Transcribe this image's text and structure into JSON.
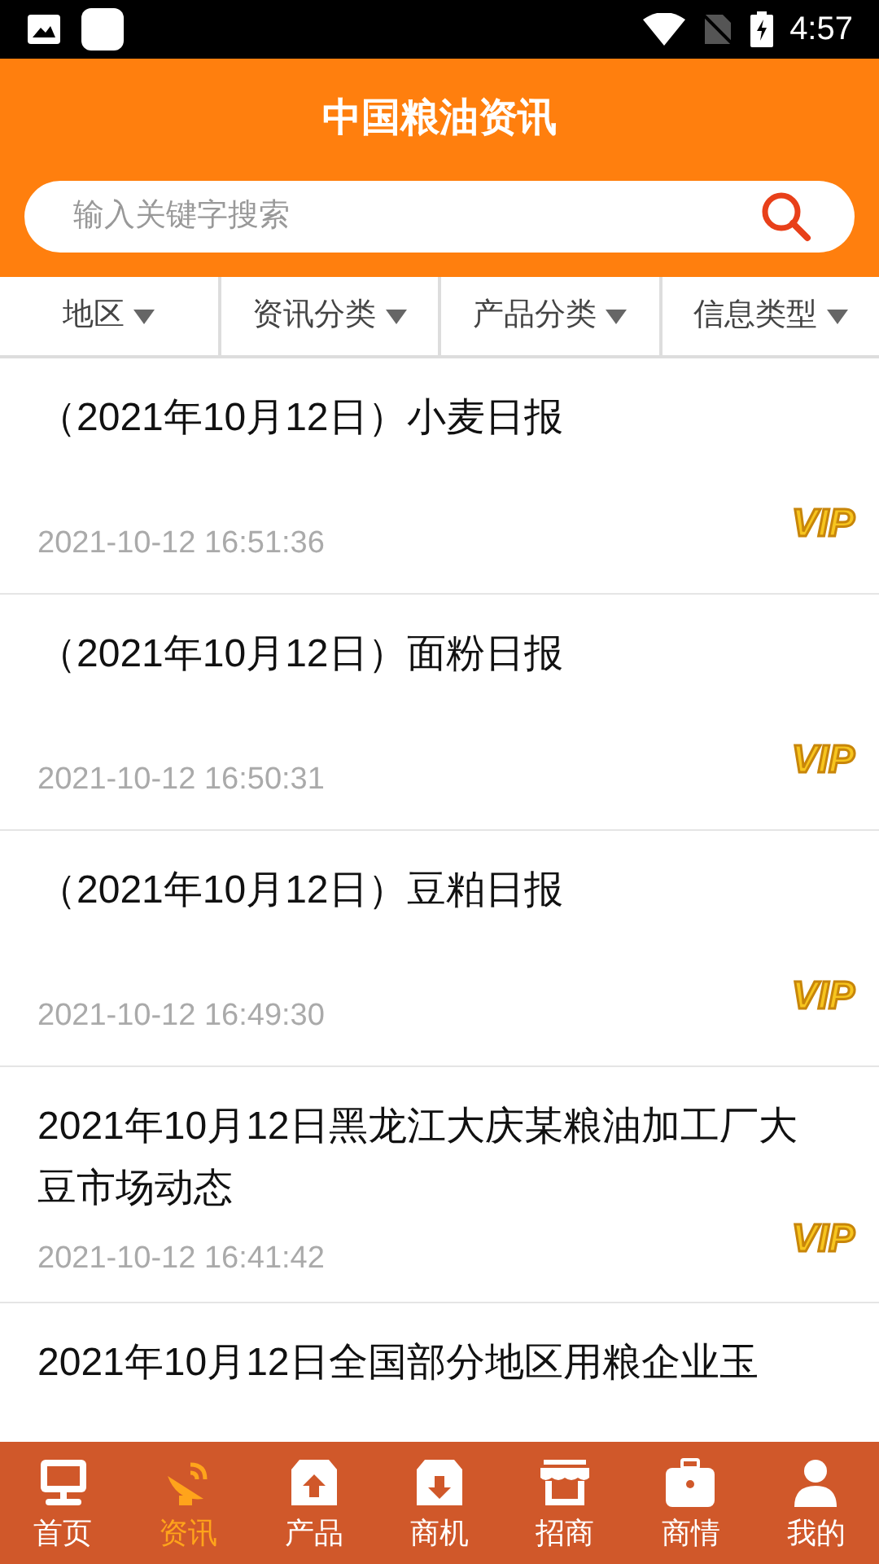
{
  "status_bar": {
    "time": "4:57"
  },
  "header": {
    "title": "中国粮油资讯",
    "search": {
      "placeholder": "输入关键字搜索"
    }
  },
  "filters": [
    {
      "label": "地区"
    },
    {
      "label": "资讯分类"
    },
    {
      "label": "产品分类"
    },
    {
      "label": "信息类型"
    }
  ],
  "articles": [
    {
      "title": "（2021年10月12日）小麦日报",
      "time": "2021-10-12 16:51:36",
      "badge": "VIP"
    },
    {
      "title": "（2021年10月12日）面粉日报",
      "time": "2021-10-12 16:50:31",
      "badge": "VIP"
    },
    {
      "title": "（2021年10月12日）豆粕日报",
      "time": "2021-10-12 16:49:30",
      "badge": "VIP"
    },
    {
      "title": "2021年10月12日黑龙江大庆某粮油加工厂大豆市场动态",
      "time": "2021-10-12 16:41:42",
      "badge": "VIP"
    },
    {
      "title": "2021年10月12日全国部分地区用粮企业玉"
    }
  ],
  "nav": [
    {
      "label": "首页",
      "selected": false
    },
    {
      "label": "资讯",
      "selected": true
    },
    {
      "label": "产品",
      "selected": false
    },
    {
      "label": "商机",
      "selected": false
    },
    {
      "label": "招商",
      "selected": false
    },
    {
      "label": "商情",
      "selected": false
    },
    {
      "label": "我的",
      "selected": false
    }
  ]
}
